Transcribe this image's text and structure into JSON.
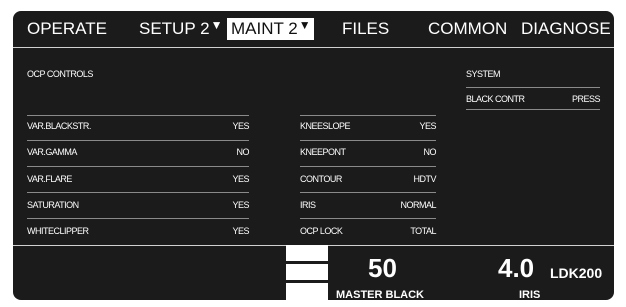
{
  "menu": {
    "tabs": [
      {
        "label": "OPERATE"
      },
      {
        "label": "SETUP 2",
        "dropdown": "▼"
      },
      {
        "label": "MAINT 2",
        "dropdown": "▼",
        "active": true
      },
      {
        "label": "FILES"
      },
      {
        "label": "COMMON"
      },
      {
        "label": "DIAGNOSE"
      }
    ]
  },
  "panel": {
    "title": "OCP CONTROLS",
    "left_rows": [
      {
        "label": "VAR.BLACKSTR.",
        "value": "YES"
      },
      {
        "label": "VAR.GAMMA",
        "value": "NO"
      },
      {
        "label": "VAR.FLARE",
        "value": "YES"
      },
      {
        "label": "SATURATION",
        "value": "YES"
      },
      {
        "label": "WHITECLIPPER",
        "value": "YES"
      }
    ],
    "right_rows": [
      {
        "label": "KNEESLOPE",
        "value": "YES"
      },
      {
        "label": "KNEEPONT",
        "value": "NO"
      },
      {
        "label": "CONTOUR",
        "value": "HDTV"
      },
      {
        "label": "IRIS",
        "value": "NORMAL"
      },
      {
        "label": "OCP LOCK",
        "value": "TOTAL"
      }
    ],
    "system": {
      "title": "SYSTEM",
      "row": {
        "label": "BLACK CONTR",
        "value": "PRESS"
      }
    }
  },
  "status": {
    "master_black": {
      "value": "50",
      "label": "MASTER BLACK"
    },
    "iris": {
      "value": "4.0",
      "label": "IRIS"
    },
    "camera": "LDK200"
  },
  "colors": {
    "background": "#1b1b1b",
    "text": "#ffffff",
    "divider": "#8a8a8a"
  }
}
